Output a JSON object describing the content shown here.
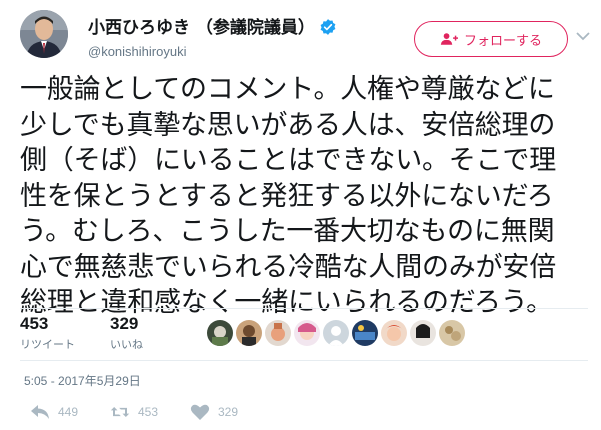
{
  "header": {
    "display_name": "小西ひろゆき （参議院議員）",
    "handle": "@konishihiroyuki",
    "verified_icon": "verified-badge-icon",
    "follow_label": "フォローする",
    "follow_icon": "follow-person-plus-icon",
    "menu_icon": "chevron-down-icon",
    "accent_color": "#e0245e",
    "verified_color": "#1da1f2"
  },
  "tweet": {
    "lines": [
      "一般論としてのコメント。人権や尊厳などに",
      "少しでも真摯な思いがある人は、安倍総理の",
      "側（そば）にいることはできない。そこで理",
      "性を保とうとすると発狂する以外にないだろ",
      "う。むしろ、こうした一番大切なものに無関",
      "心で無慈悲でいられる冷酷な人間のみが安倍",
      "総理と違和感なく一緒にいられるのだろう。"
    ]
  },
  "stats": {
    "retweets_count": "453",
    "retweets_label": "リツイート",
    "likes_count": "329",
    "likes_label": "いいね"
  },
  "timestamp": "5:05 - 2017年5月29日",
  "actions": {
    "reply_icon": "reply-icon",
    "reply_count": "449",
    "retweet_icon": "retweet-icon",
    "retweet_count": "453",
    "like_icon": "heart-icon",
    "like_count": "329"
  }
}
